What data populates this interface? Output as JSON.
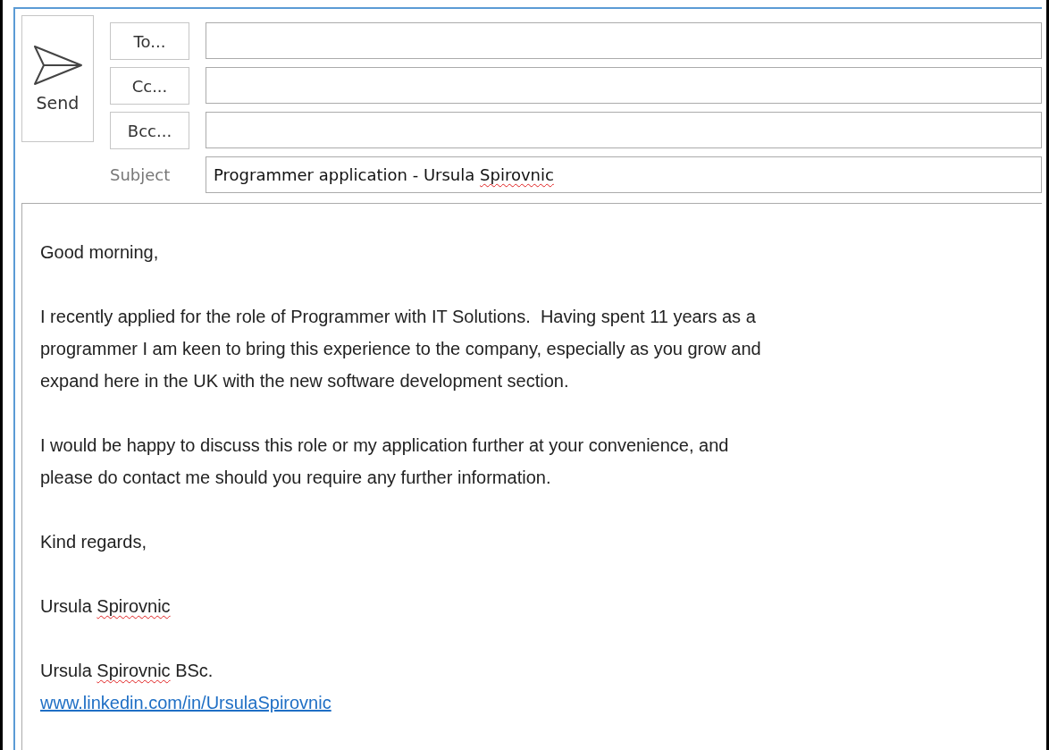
{
  "send_button": {
    "label": "Send"
  },
  "recipients": [
    {
      "label": "To..."
    },
    {
      "label": "Cc..."
    },
    {
      "label": "Bcc..."
    }
  ],
  "subject": {
    "label": "Subject",
    "value": [
      {
        "text": "Programmer application - Ursula ",
        "misspelled": false
      },
      {
        "text": "Spirovnic",
        "misspelled": true
      }
    ]
  },
  "body": [
    {
      "lines": [
        {
          "kind": "text",
          "segments": [
            {
              "text": "Good morning,",
              "misspelled": false
            }
          ]
        }
      ]
    },
    {
      "lines": [
        {
          "kind": "text",
          "segments": [
            {
              "text": "I recently applied for the role of Programmer with IT Solutions.  Having spent 11 years as a",
              "misspelled": false
            }
          ]
        },
        {
          "kind": "text",
          "segments": [
            {
              "text": "programmer I am keen to bring this experience to the company, especially as you grow and",
              "misspelled": false
            }
          ]
        },
        {
          "kind": "text",
          "segments": [
            {
              "text": "expand here in the UK with the new software development section.",
              "misspelled": false
            }
          ]
        }
      ]
    },
    {
      "lines": [
        {
          "kind": "text",
          "segments": [
            {
              "text": "I would be happy to discuss this role or my application further at your convenience, and",
              "misspelled": false
            }
          ]
        },
        {
          "kind": "text",
          "segments": [
            {
              "text": "please do contact me should you require any further information.",
              "misspelled": false
            }
          ]
        }
      ]
    },
    {
      "lines": [
        {
          "kind": "text",
          "segments": [
            {
              "text": "Kind regards,",
              "misspelled": false
            }
          ]
        }
      ]
    },
    {
      "lines": [
        {
          "kind": "text",
          "segments": [
            {
              "text": "Ursula ",
              "misspelled": false
            },
            {
              "text": "Spirovnic",
              "misspelled": true
            }
          ]
        }
      ]
    },
    {
      "lines": [
        {
          "kind": "text",
          "segments": [
            {
              "text": "Ursula ",
              "misspelled": false
            },
            {
              "text": "Spirovnic",
              "misspelled": true
            },
            {
              "text": " BSc.",
              "misspelled": false
            }
          ]
        },
        {
          "kind": "link",
          "segments": [
            {
              "text": "www.linkedin.com/in/UrsulaSpirovnic",
              "misspelled": false
            }
          ]
        }
      ]
    }
  ]
}
